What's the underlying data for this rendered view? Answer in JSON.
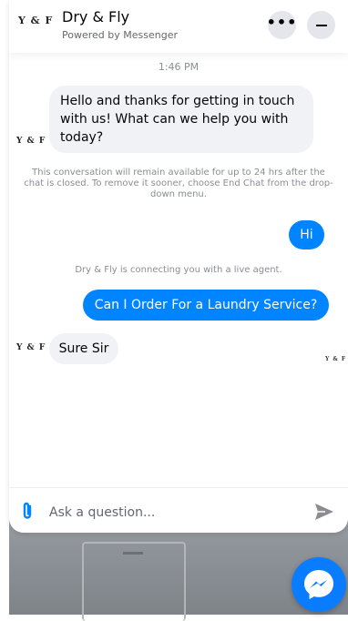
{
  "header": {
    "logo_text": "Y & F",
    "title": "Dry & Fly",
    "subtitle": "Powered by Messenger",
    "more_label": "•••"
  },
  "conversation": {
    "timestamp": "1:46 PM",
    "messages": [
      {
        "from": "business",
        "text": "Hello and thanks for getting in touch with us! What can we help you with today?"
      },
      {
        "from": "system",
        "text": "This conversation will remain available for up to 24 hrs after the chat is closed. To remove it sooner, choose End Chat from the drop-down menu."
      },
      {
        "from": "user",
        "text": "Hi"
      },
      {
        "from": "system",
        "text": "Dry & Fly is connecting you with a live agent."
      },
      {
        "from": "user",
        "text": "Can I Order For a Laundry Service?"
      },
      {
        "from": "business",
        "text": "Sure Sir"
      }
    ],
    "seen_logo_text": "Y & F"
  },
  "composer": {
    "placeholder": "Ask a question..."
  },
  "colors": {
    "accent": "#0084ff",
    "fab": "#0a7cff",
    "incoming_bubble": "#f0f2f5",
    "meta_text": "#8a8d91"
  },
  "icons": {
    "attach": "paperclip-icon",
    "send": "send-icon",
    "messenger": "messenger-icon",
    "more": "more-icon",
    "minimize": "minimize-icon"
  }
}
